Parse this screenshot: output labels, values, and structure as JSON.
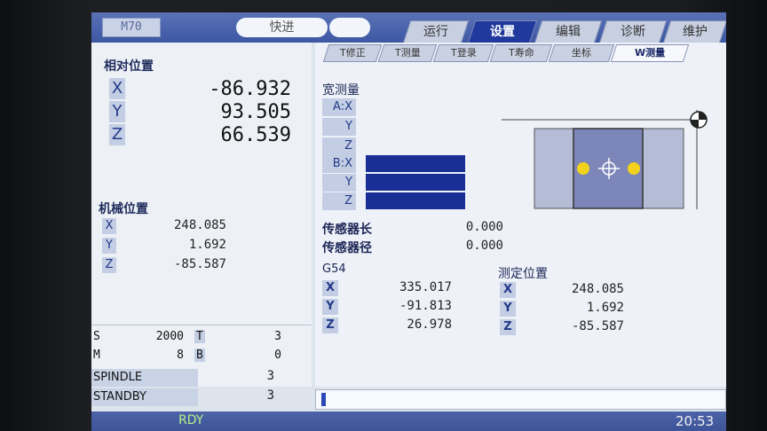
{
  "header": {
    "model": "M70",
    "mode": "快进",
    "tabs": [
      {
        "label": "运行",
        "active": false
      },
      {
        "label": "设置",
        "active": true
      },
      {
        "label": "编辑",
        "active": false
      },
      {
        "label": "诊断",
        "active": false
      },
      {
        "label": "维护",
        "active": false
      }
    ]
  },
  "relative_position": {
    "title": "相对位置",
    "x_label": "X",
    "x": "-86.932",
    "y_label": "Y",
    "y": "93.505",
    "z_label": "Z",
    "z": "66.539"
  },
  "machine_position": {
    "title": "机械位置",
    "x_label": "X",
    "x": "248.085",
    "y_label": "Y",
    "y": "1.692",
    "z_label": "Z",
    "z": "-85.587"
  },
  "spindle_info": {
    "s_label": "S",
    "s": "2000",
    "t_label": "T",
    "t": "3",
    "m_label": "M",
    "m": "8",
    "b_label": "B",
    "b": "0",
    "spindle_label": "SPINDLE",
    "spindle": "3",
    "standby_label": "STANDBY",
    "standby": "3"
  },
  "subtabs": [
    {
      "label": "T修正",
      "active": false
    },
    {
      "label": "T测量",
      "active": false
    },
    {
      "label": "T登录",
      "active": false
    },
    {
      "label": "T寿命",
      "active": false
    },
    {
      "label": "坐标",
      "active": false
    },
    {
      "label": "W测量",
      "active": true
    }
  ],
  "width_measure": {
    "title": "宽测量",
    "a_labels": [
      "A:X",
      "Y",
      "Z"
    ],
    "b_labels": [
      "B:X",
      "Y",
      "Z"
    ]
  },
  "sensor": {
    "length_label": "传感器长",
    "length": "0.000",
    "radius_label": "传感器径",
    "radius": "0.000"
  },
  "g54": {
    "label": "G54",
    "x_label": "X",
    "x": "335.017",
    "y_label": "Y",
    "y": "-91.813",
    "z_label": "Z",
    "z": "26.978"
  },
  "measured_position": {
    "title": "测定位置",
    "x_label": "X",
    "x": "248.085",
    "y_label": "Y",
    "y": "1.692",
    "z_label": "Z",
    "z": "-85.587"
  },
  "status": {
    "state": "RDY",
    "time": "20:53"
  },
  "colors": {
    "accent": "#1f3a9c",
    "header": "#3d57a4",
    "probe_dot": "#f2d21b"
  }
}
